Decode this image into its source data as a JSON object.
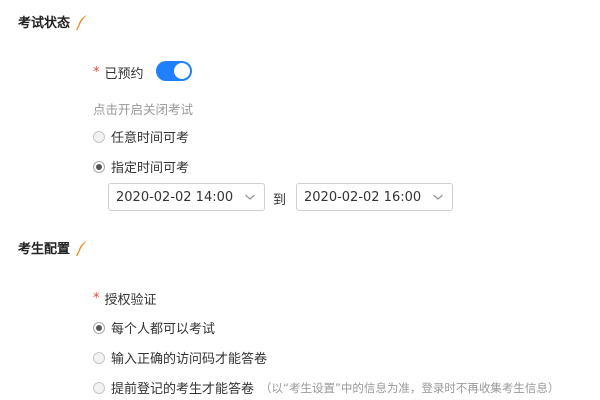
{
  "exam_status": {
    "title": "考试状态",
    "booked_label": "已预约",
    "booked_toggle_on": true,
    "hint": "点击开启关闭考试",
    "options": [
      "任意时间可考",
      "指定时间可考"
    ],
    "selected_option": 1,
    "start_time": "2020-02-02 14:00",
    "to_label": "到",
    "end_time": "2020-02-02 16:00"
  },
  "candidate_config": {
    "title": "考生配置",
    "auth_label": "授权验证",
    "options": [
      "每个人都可以考试",
      "输入正确的访问码才能答卷",
      "提前登记的考生才能答卷"
    ],
    "option3_note": "（以“考生设置”中的信息为准，登录时不再收集考生信息）",
    "selected_option": 0
  },
  "colors": {
    "accent": "#1f7fff",
    "required": "#e8453c",
    "edit_icon": "#f28a1e",
    "hint": "#999999"
  },
  "icons": {
    "section_edit": "feather-pen-icon",
    "select_arrow": "chevron-down-icon"
  }
}
